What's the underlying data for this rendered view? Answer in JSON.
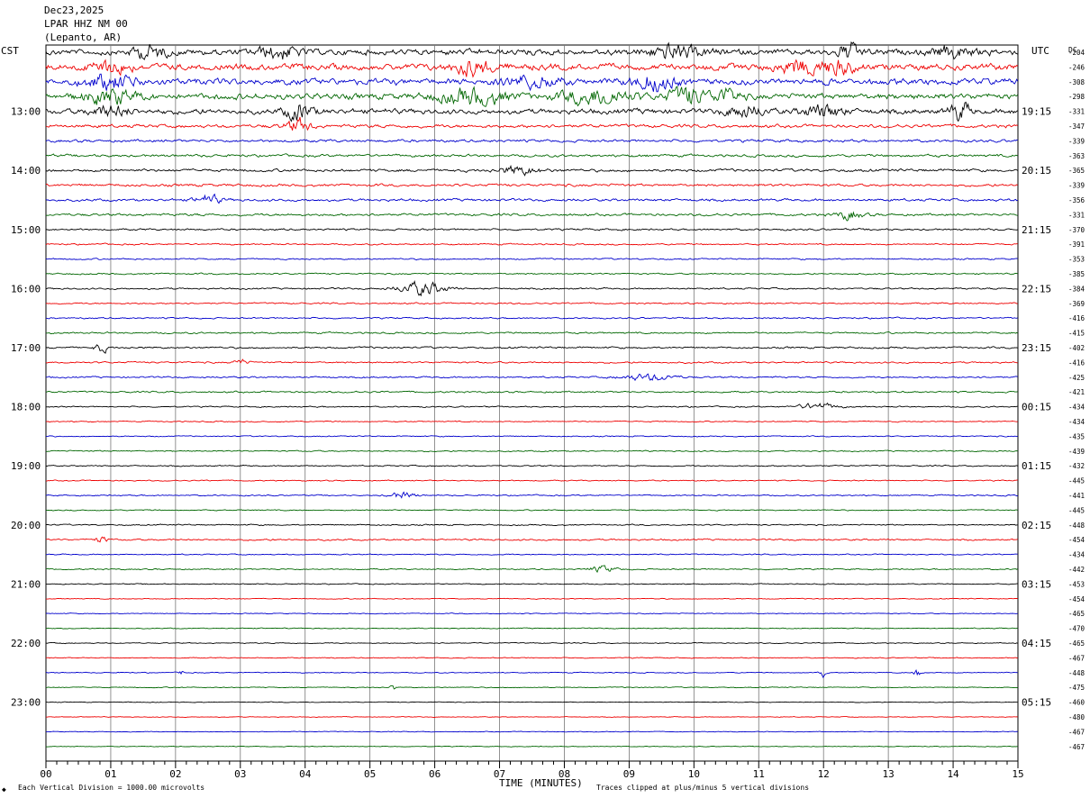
{
  "header": {
    "date": "Dec23,2025",
    "station": "LPAR HHZ NM 00",
    "location": "(Lepanto, AR)",
    "left_tz": "CST",
    "right_tz": "UTC",
    "dc_label": "DC"
  },
  "footer": {
    "xlabel": "TIME (MINUTES)",
    "scale_note": "Each Vertical Division = 1000.00 microvolts",
    "clip_note": "Traces clipped at plus/minus 5 vertical divisions",
    "corner_mark": "◆"
  },
  "chart_data": {
    "type": "line",
    "title": "LPAR HHZ NM 00",
    "xlabel": "TIME (MINUTES)",
    "xlim": [
      0,
      15
    ],
    "x_ticks": [
      "00",
      "01",
      "02",
      "03",
      "04",
      "05",
      "06",
      "07",
      "08",
      "09",
      "10",
      "11",
      "12",
      "13",
      "14",
      "15"
    ],
    "colors": [
      "#000000",
      "#ee0000",
      "#0000cc",
      "#006600"
    ],
    "left_hour_labels": [
      "13:00",
      "14:00",
      "15:00",
      "16:00",
      "17:00",
      "18:00",
      "19:00",
      "20:00",
      "21:00",
      "22:00",
      "23:00"
    ],
    "right_hour_labels": [
      "19:15",
      "20:15",
      "21:15",
      "22:15",
      "23:15",
      "00:15",
      "01:15",
      "02:15",
      "03:15",
      "04:15",
      "05:15"
    ],
    "first_label_row": 4,
    "label_every_rows": 4,
    "dc_offsets": [
      -204,
      -246,
      -308,
      -298,
      -331,
      -347,
      -339,
      -363,
      -365,
      -339,
      -356,
      -331,
      -370,
      -391,
      -353,
      -385,
      -384,
      -369,
      -416,
      -415,
      -402,
      -416,
      -425,
      -421,
      -434,
      -434,
      -435,
      -439,
      -432,
      -445,
      -441,
      -445,
      -448,
      -454,
      -434,
      -442,
      -453,
      -454,
      -465,
      -470,
      -465,
      -467,
      -448,
      -475,
      -460,
      -480,
      -467,
      -467
    ],
    "row_amplitude": [
      3.2,
      3.4,
      3.3,
      3.2,
      2.8,
      1.8,
      1.5,
      1.4,
      1.5,
      1.4,
      1.4,
      1.3,
      1.0,
      0.8,
      0.8,
      0.8,
      0.9,
      0.8,
      0.8,
      0.9,
      1.0,
      0.9,
      0.9,
      0.9,
      0.7,
      0.6,
      0.6,
      0.7,
      0.7,
      0.6,
      0.7,
      0.6,
      0.7,
      0.9,
      0.6,
      0.7,
      0.5,
      0.5,
      0.5,
      0.5,
      0.5,
      0.5,
      0.5,
      0.5,
      0.4,
      0.4,
      0.4,
      0.4
    ],
    "events": [
      {
        "row": 0,
        "minute": 1.6,
        "amp": 6,
        "width": 0.25
      },
      {
        "row": 0,
        "minute": 3.6,
        "amp": 6,
        "width": 0.3
      },
      {
        "row": 0,
        "minute": 9.7,
        "amp": 6,
        "width": 0.4
      },
      {
        "row": 0,
        "minute": 12.4,
        "amp": 9,
        "width": 0.15
      },
      {
        "row": 0,
        "minute": 14.0,
        "amp": 5,
        "width": 0.3
      },
      {
        "row": 1,
        "minute": 1.0,
        "amp": 6,
        "width": 0.3
      },
      {
        "row": 1,
        "minute": 6.6,
        "amp": 7,
        "width": 0.3
      },
      {
        "row": 1,
        "minute": 11.6,
        "amp": 6,
        "width": 0.3
      },
      {
        "row": 1,
        "minute": 12.2,
        "amp": 6,
        "width": 0.3
      },
      {
        "row": 2,
        "minute": 1.0,
        "amp": 6,
        "width": 0.4
      },
      {
        "row": 2,
        "minute": 7.5,
        "amp": 5,
        "width": 0.4
      },
      {
        "row": 2,
        "minute": 9.4,
        "amp": 8,
        "width": 0.3
      },
      {
        "row": 3,
        "minute": 1.0,
        "amp": 6,
        "width": 0.4
      },
      {
        "row": 3,
        "minute": 6.6,
        "amp": 7,
        "width": 0.5
      },
      {
        "row": 3,
        "minute": 8.5,
        "amp": 7,
        "width": 0.5
      },
      {
        "row": 3,
        "minute": 9.9,
        "amp": 8,
        "width": 0.3
      },
      {
        "row": 3,
        "minute": 10.5,
        "amp": 6,
        "width": 0.2
      },
      {
        "row": 4,
        "minute": 1.0,
        "amp": 5,
        "width": 0.3
      },
      {
        "row": 4,
        "minute": 3.9,
        "amp": 8,
        "width": 0.2
      },
      {
        "row": 4,
        "minute": 10.8,
        "amp": 5,
        "width": 0.3
      },
      {
        "row": 4,
        "minute": 12.0,
        "amp": 6,
        "width": 0.3
      },
      {
        "row": 4,
        "minute": 14.1,
        "amp": 9,
        "width": 0.15
      },
      {
        "row": 5,
        "minute": 3.9,
        "amp": 6,
        "width": 0.2
      },
      {
        "row": 8,
        "minute": 7.3,
        "amp": 4,
        "width": 0.3
      },
      {
        "row": 10,
        "minute": 2.5,
        "amp": 4,
        "width": 0.2
      },
      {
        "row": 11,
        "minute": 12.4,
        "amp": 4,
        "width": 0.2
      },
      {
        "row": 16,
        "minute": 5.8,
        "amp": 6,
        "width": 0.35
      },
      {
        "row": 20,
        "minute": 0.85,
        "amp": 4,
        "width": 0.1
      },
      {
        "row": 21,
        "minute": 3.0,
        "amp": 3,
        "width": 0.1
      },
      {
        "row": 22,
        "minute": 9.3,
        "amp": 3,
        "width": 0.4
      },
      {
        "row": 24,
        "minute": 11.9,
        "amp": 3,
        "width": 0.3
      },
      {
        "row": 30,
        "minute": 5.5,
        "amp": 3,
        "width": 0.2
      },
      {
        "row": 33,
        "minute": 0.85,
        "amp": 3,
        "width": 0.1
      },
      {
        "row": 35,
        "minute": 8.6,
        "amp": 3,
        "width": 0.2
      },
      {
        "row": 42,
        "minute": 11.97,
        "amp": 12,
        "width": 0.03
      },
      {
        "row": 42,
        "minute": 13.45,
        "amp": 4,
        "width": 0.05
      },
      {
        "row": 42,
        "minute": 2.1,
        "amp": 3,
        "width": 0.03
      },
      {
        "row": 43,
        "minute": 5.35,
        "amp": 4,
        "width": 0.04
      }
    ]
  }
}
